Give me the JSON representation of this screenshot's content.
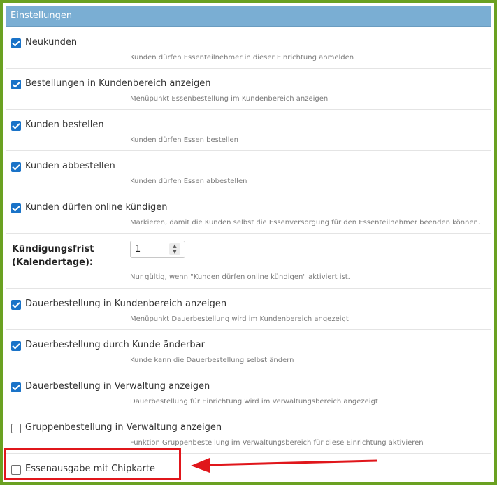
{
  "panel": {
    "title": "Einstellungen"
  },
  "settings": [
    {
      "label": "Neukunden",
      "description": "Kunden dürfen Essenteilnehmer in dieser Einrichtung anmelden",
      "checked": true
    },
    {
      "label": "Bestellungen in Kundenbereich anzeigen",
      "description": "Menüpunkt Essenbestellung im Kundenbereich anzeigen",
      "checked": true
    },
    {
      "label": "Kunden bestellen",
      "description": "Kunden dürfen Essen bestellen",
      "checked": true
    },
    {
      "label": "Kunden abbestellen",
      "description": "Kunden dürfen Essen abbestellen",
      "checked": true
    },
    {
      "label": "Kunden dürfen online kündigen",
      "description": "Markieren, damit die Kunden selbst die Essenversorgung für den Essenteilnehmer beenden können.",
      "checked": true
    }
  ],
  "kuendigungsfrist": {
    "label_line1": "Kündigungsfrist",
    "label_line2": "(Kalendertage):",
    "value": "1",
    "description": "Nur gültig, wenn \"Kunden dürfen online kündigen\" aktiviert ist."
  },
  "settings2": [
    {
      "label": "Dauerbestellung in Kundenbereich anzeigen",
      "description": "Menüpunkt Dauerbestellung wird im Kundenbereich angezeigt",
      "checked": true
    },
    {
      "label": "Dauerbestellung durch Kunde änderbar",
      "description": "Kunde kann die Dauerbestellung selbst ändern",
      "checked": true
    },
    {
      "label": "Dauerbestellung in Verwaltung anzeigen",
      "description": "Dauerbestellung für Einrichtung wird im Verwaltungsbereich angezeigt",
      "checked": true
    },
    {
      "label": "Gruppenbestellung in Verwaltung anzeigen",
      "description": "Funktion Gruppenbestellung im Verwaltungsbereich für diese Einrichtung aktivieren",
      "checked": false
    },
    {
      "label": "Essenausgabe mit Chipkarte",
      "checked": false
    }
  ],
  "colors": {
    "frame": "#6aa121",
    "header": "#7aaed3",
    "checkbox": "#1a73c8",
    "annotation": "#e0161b"
  }
}
